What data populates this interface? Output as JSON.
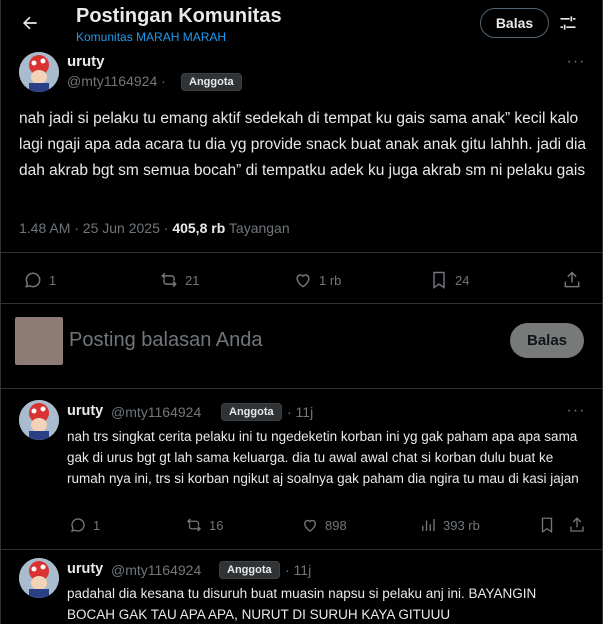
{
  "header": {
    "title": "Postingan Komunitas",
    "community": "Komunitas MARAH MARAH",
    "reply_button": "Balas"
  },
  "main_post": {
    "author": "uruty",
    "handle": "@mty1164924",
    "separator": "·",
    "badge": "Anggota",
    "text": "nah jadi si pelaku tu emang aktif sedekah di tempat ku gais sama anak” kecil kalo lagi ngaji apa ada acara tu dia yg provide snack buat anak anak gitu lahhh. jadi dia dah akrab bgt sm semua bocah” di tempatku adek ku juga akrab sm ni pelaku gais",
    "timestamp": "1.48 AM · 25 Jun 2025 · ",
    "views_count": "405,8 rb",
    "views_label": "Tayangan",
    "actions": {
      "replies": "1",
      "reposts": "21",
      "likes": "1 rb",
      "bookmarks": "24"
    }
  },
  "composer": {
    "placeholder": "Posting balasan Anda",
    "button": "Balas"
  },
  "replies": [
    {
      "author": "uruty",
      "handle": "@mty1164924",
      "badge": "Anggota",
      "time": "· 11j",
      "text": "nah trs singkat cerita pelaku ini tu ngedeketin korban ini yg gak paham apa apa sama gak di urus bgt gt lah sama keluarga. dia tu awal awal chat si korban dulu buat ke rumah nya ini, trs si korban ngikut aj soalnya gak paham dia ngira tu mau di kasi jajan",
      "actions": {
        "replies": "1",
        "reposts": "16",
        "likes": "898",
        "views": "393 rb"
      }
    },
    {
      "author": "uruty",
      "handle": "@mty1164924",
      "badge": "Anggota",
      "time": "· 11j",
      "text": "padahal dia kesana tu disuruh buat muasin napsu si pelaku anj ini. BAYANGIN BOCAH GAK TAU APA APA, NURUT DI SURUH KAYA GITUUU"
    }
  ],
  "colors": {
    "accent": "#1d9bf0",
    "muted": "#71767b",
    "background": "#000000",
    "border": "#2f3336"
  }
}
